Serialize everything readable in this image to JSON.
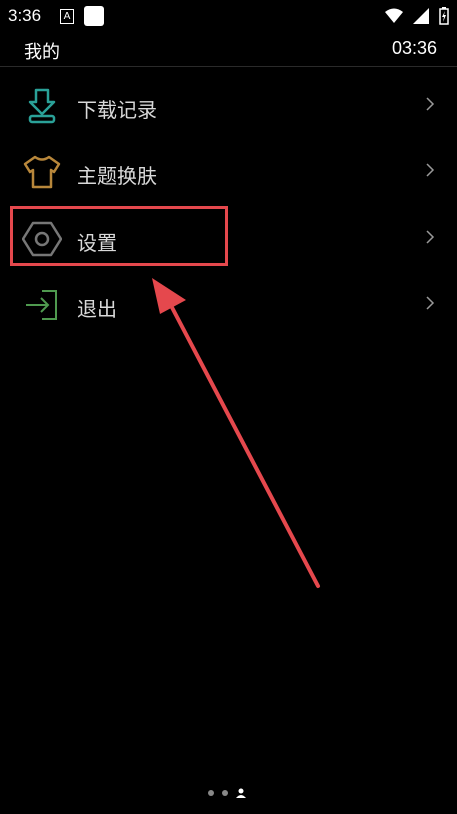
{
  "statusbar": {
    "time": "3:36",
    "a_icon_text": "A",
    "icons": [
      "wifi-icon",
      "signal-icon",
      "battery-icon"
    ]
  },
  "header": {
    "title": "我的",
    "clock": "03:36"
  },
  "menu": {
    "items": [
      {
        "label": "下载记录",
        "icon": "download-icon"
      },
      {
        "label": "主题换肤",
        "icon": "tshirt-icon"
      },
      {
        "label": "设置",
        "icon": "settings-hex-icon"
      },
      {
        "label": "退出",
        "icon": "logout-icon"
      }
    ]
  },
  "colors": {
    "highlight": "#e5484d",
    "download_icon": "#2aa198",
    "theme_icon": "#b8873b",
    "settings_icon": "#777777",
    "logout_icon": "#4f9a4f"
  }
}
